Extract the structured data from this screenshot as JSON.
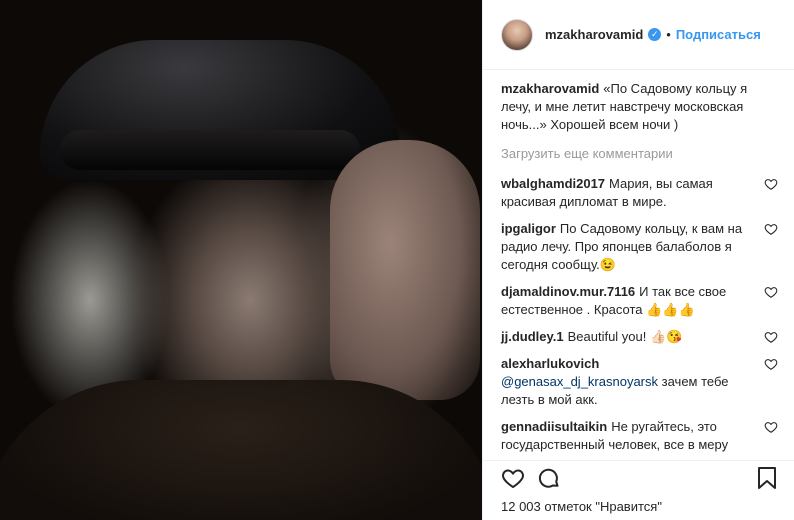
{
  "header": {
    "username": "mzakharovamid",
    "separator": "•",
    "follow_label": "Подписаться"
  },
  "caption": {
    "username": "mzakharovamid",
    "text": "«По Садовому кольцу я лечу, и мне летит навстречу московская ночь...» Хорошей всем ночи )"
  },
  "load_more": "Загрузить еще комментарии",
  "comments": [
    {
      "username": "wbalghamdi2017",
      "text": "Мария, вы самая красивая дипломат в мире."
    },
    {
      "username": "ipgaligor",
      "text": "По Садовому кольцу, к вам на радио лечу. Про японцев балаболов я сегодня сообщу.",
      "emoji": "😉"
    },
    {
      "username": "djamaldinov.mur.7116",
      "text": "И так все свое естественное . Красота",
      "emoji": "👍👍👍"
    },
    {
      "username": "jj.dudley.1",
      "text": "Beautiful you!",
      "emoji": "👍🏻😘"
    },
    {
      "username": "alexharlukovich",
      "mention": "@genasax_dj_krasnoyarsk",
      "text": "зачем тебе лезть в мой акк."
    },
    {
      "username": "gennadiisultaikin",
      "text": "Не ругайтесь, это государственный человек, все в меру"
    }
  ],
  "likes_text": "12 003 отметок \"Нравится\"",
  "icons": [
    "heart-icon",
    "comment-icon",
    "bookmark-icon",
    "verified-icon"
  ]
}
